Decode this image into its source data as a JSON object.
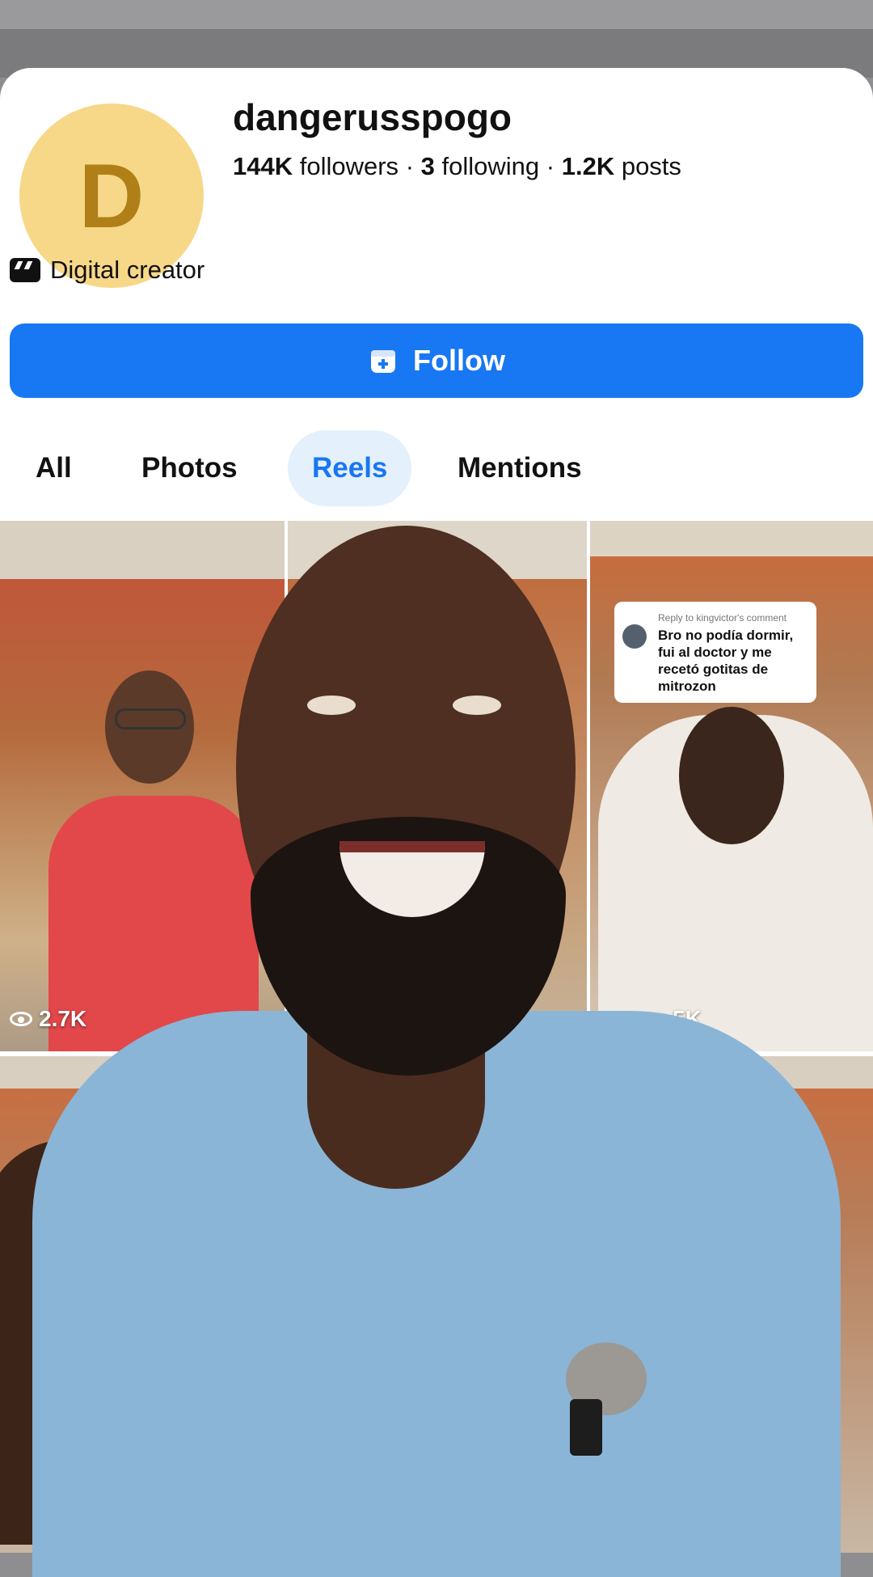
{
  "profile": {
    "avatar_letter": "D",
    "username": "dangerusspogo",
    "followers_count": "144K",
    "followers_label": "followers",
    "separator": "·",
    "following_count": "3",
    "following_label": "following",
    "posts_count": "1.2K",
    "posts_label": "posts",
    "category": "Digital creator",
    "category_icon": "clapperboard-icon"
  },
  "actions": {
    "follow_label": "Follow",
    "follow_icon": "add-person-icon"
  },
  "tabs": [
    {
      "label": "All",
      "active": false
    },
    {
      "label": "Photos",
      "active": false
    },
    {
      "label": "Reels",
      "active": true
    },
    {
      "label": "Mentions",
      "active": false
    }
  ],
  "reels": [
    {
      "views": "2.7K"
    },
    {
      "views": ""
    },
    {
      "views": "5K",
      "comment_reply": "Reply to kingvictor's comment",
      "comment_text": "Bro no podía dormir, fui al doctor y me recetó gotitas de mitrozon"
    }
  ],
  "colors": {
    "accent": "#1877f2",
    "avatar_bg": "#f7d888",
    "avatar_letter": "#b07f17",
    "active_tab_bg": "#e5f0fd"
  }
}
